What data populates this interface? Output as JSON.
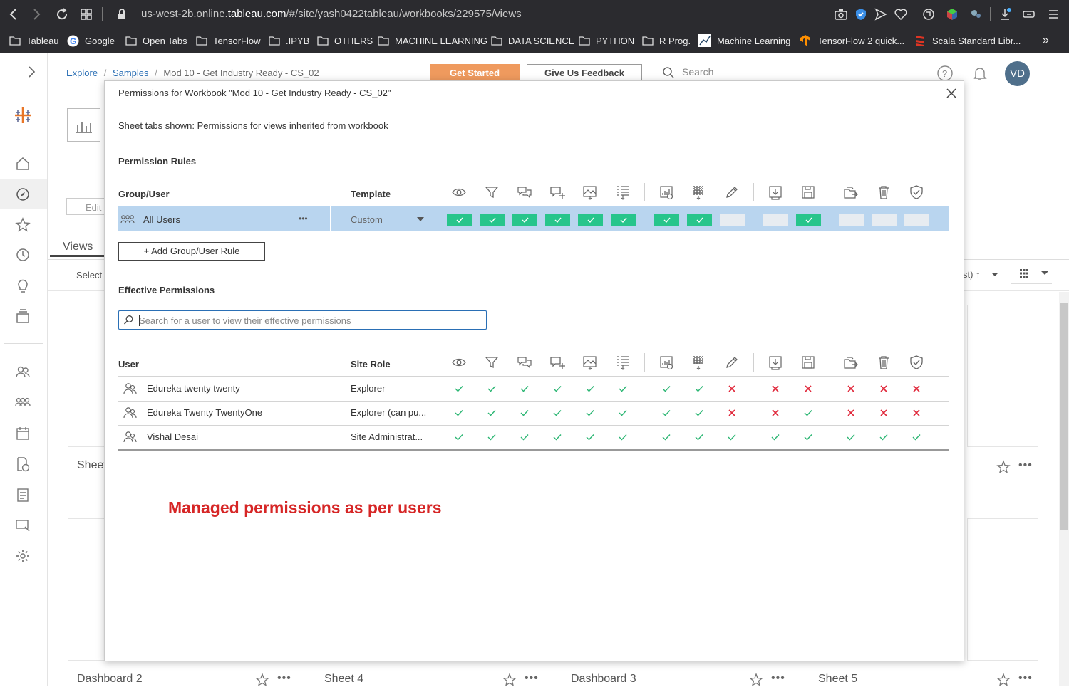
{
  "browser": {
    "url_prefix": "us-west-2b.online.",
    "url_domain": "tableau.com",
    "url_path": "/#/site/yash0422tableau/workbooks/229575/views",
    "bookmarks": [
      "Tableau",
      "Google",
      "Open Tabs",
      "TensorFlow",
      ".IPYB",
      "OTHERS",
      "MACHINE LEARNING",
      "DATA SCIENCE",
      "PYTHON",
      "R Prog.",
      "Machine Learning",
      "TensorFlow 2 quick...",
      "Scala Standard Libr..."
    ],
    "more": "»"
  },
  "header": {
    "breadcrumb": [
      "Explore",
      "Samples",
      "Mod 10 - Get Industry Ready - CS_02"
    ],
    "separator": "/",
    "get_started": "Get Started",
    "feedback": "Give Us Feedback",
    "search_placeholder": "Search",
    "avatar": "VD"
  },
  "background": {
    "edit": "Edit",
    "views_tab": "Views",
    "select": "Select",
    "sort_label": "st) ↑",
    "cards": [
      "Sheet",
      "Dashboard 2",
      "Sheet 4",
      "Dashboard 3",
      "Sheet 5"
    ]
  },
  "modal": {
    "title": "Permissions for Workbook \"Mod 10 - Get Industry Ready - CS_02\"",
    "sheet_tabs_note": "Sheet tabs shown: Permissions for views inherited from workbook",
    "rules_heading": "Permission Rules",
    "col_group_user": "Group/User",
    "col_template": "Template",
    "capabilities": [
      "view-icon",
      "filter-icon",
      "view-comments-icon",
      "add-comment-icon",
      "download-image-icon",
      "download-summary-data-icon",
      "download-full-data-icon",
      "web-edit-icon",
      "overwrite-icon",
      "download-workbook-icon",
      "save-as-icon",
      "move-icon",
      "delete-icon",
      "set-permissions-icon"
    ],
    "rule": {
      "group": "All Users",
      "more": "•••",
      "template": "Custom",
      "states": [
        "allowed",
        "allowed",
        "allowed",
        "allowed",
        "allowed",
        "allowed",
        "allowed",
        "allowed",
        "unspecified",
        "unspecified",
        "allowed",
        "unspecified",
        "unspecified",
        "unspecified"
      ]
    },
    "add_rule": "+ Add Group/User Rule",
    "effective_heading": "Effective Permissions",
    "effective_search_placeholder": "Search for a user to view their effective permissions",
    "col_user": "User",
    "col_site_role": "Site Role",
    "users": [
      {
        "name": "Edureka twenty twenty",
        "role": "Explorer",
        "perms": [
          "allowed",
          "allowed",
          "allowed",
          "allowed",
          "allowed",
          "allowed",
          "allowed",
          "allowed",
          "denied",
          "denied",
          "denied",
          "denied",
          "denied",
          "denied"
        ]
      },
      {
        "name": "Edureka Twenty TwentyOne",
        "role": "Explorer (can pu...",
        "perms": [
          "allowed",
          "allowed",
          "allowed",
          "allowed",
          "allowed",
          "allowed",
          "allowed",
          "allowed",
          "denied",
          "denied",
          "allowed",
          "denied",
          "denied",
          "denied"
        ]
      },
      {
        "name": "Vishal Desai",
        "role": "Site Administrat...",
        "perms": [
          "allowed",
          "allowed",
          "allowed",
          "allowed",
          "allowed",
          "allowed",
          "allowed",
          "allowed",
          "allowed",
          "allowed",
          "allowed",
          "allowed",
          "allowed",
          "allowed"
        ]
      }
    ],
    "annotation": "Managed permissions as per users"
  },
  "colors": {
    "allowed": "#27c58b",
    "denied": "#e0283a",
    "check": "#2bb673",
    "selected_row": "#b9d5ef"
  }
}
